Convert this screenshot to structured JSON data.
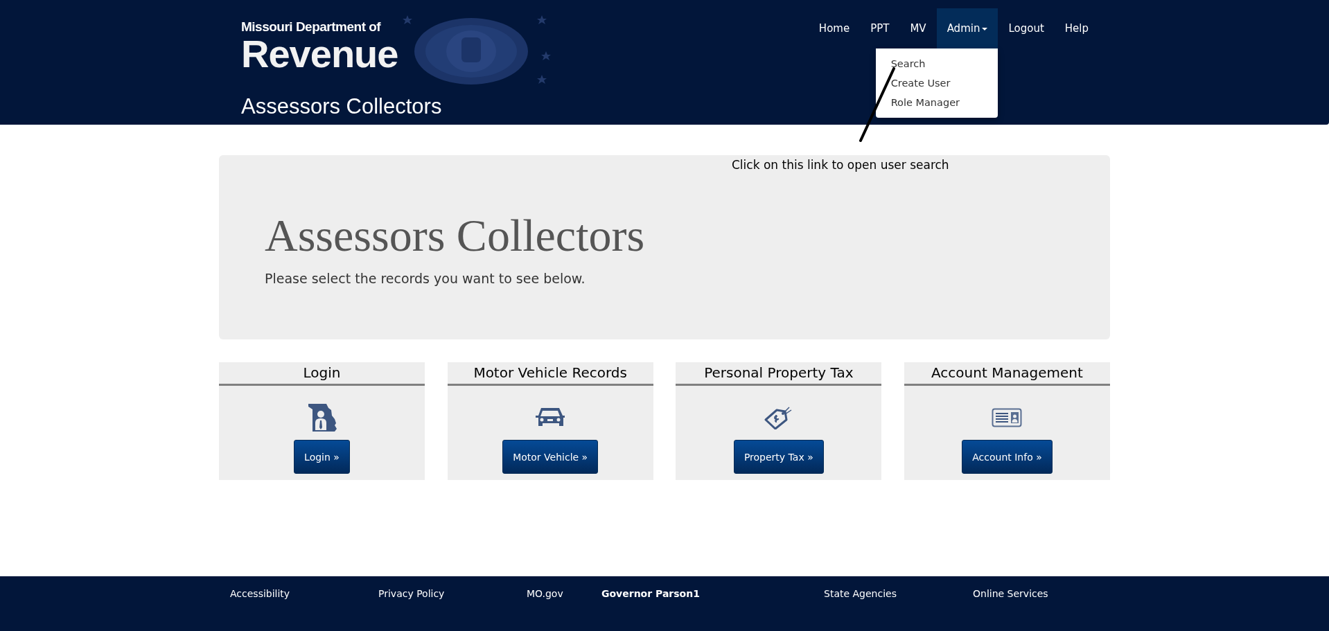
{
  "header": {
    "logo_line1": "Missouri Department of",
    "logo_line2": "Revenue",
    "site_title": "Assessors Collectors",
    "nav": [
      {
        "label": "Home",
        "kind": "link",
        "expanded": false
      },
      {
        "label": "PPT",
        "kind": "link",
        "expanded": false
      },
      {
        "label": "MV",
        "kind": "link",
        "expanded": false
      },
      {
        "label": "Admin",
        "kind": "dropdown",
        "expanded": true,
        "menu": [
          "Search",
          "Create User",
          "Role Manager"
        ]
      },
      {
        "label": "Logout",
        "kind": "link",
        "expanded": false
      },
      {
        "label": "Help",
        "kind": "link",
        "expanded": false
      }
    ]
  },
  "annotation": {
    "text": "Click on this link to open user search"
  },
  "hero": {
    "title": "Assessors Collectors",
    "subtitle": "Please select the records you want to see below."
  },
  "cards": [
    {
      "title": "Login",
      "button": "Login »"
    },
    {
      "title": "Motor Vehicle Records",
      "button": "Motor Vehicle »"
    },
    {
      "title": "Personal Property Tax",
      "button": "Property Tax »"
    },
    {
      "title": "Account Management",
      "button": "Account Info »"
    }
  ],
  "footer": [
    {
      "label": "Accessibility",
      "bold": false
    },
    {
      "label": "Privacy Policy",
      "bold": false
    },
    {
      "label": "MO.gov",
      "bold": false
    },
    {
      "label": "Governor Parson1",
      "bold": true
    },
    {
      "label": "State Agencies",
      "bold": false
    },
    {
      "label": "Online Services",
      "bold": false
    }
  ]
}
